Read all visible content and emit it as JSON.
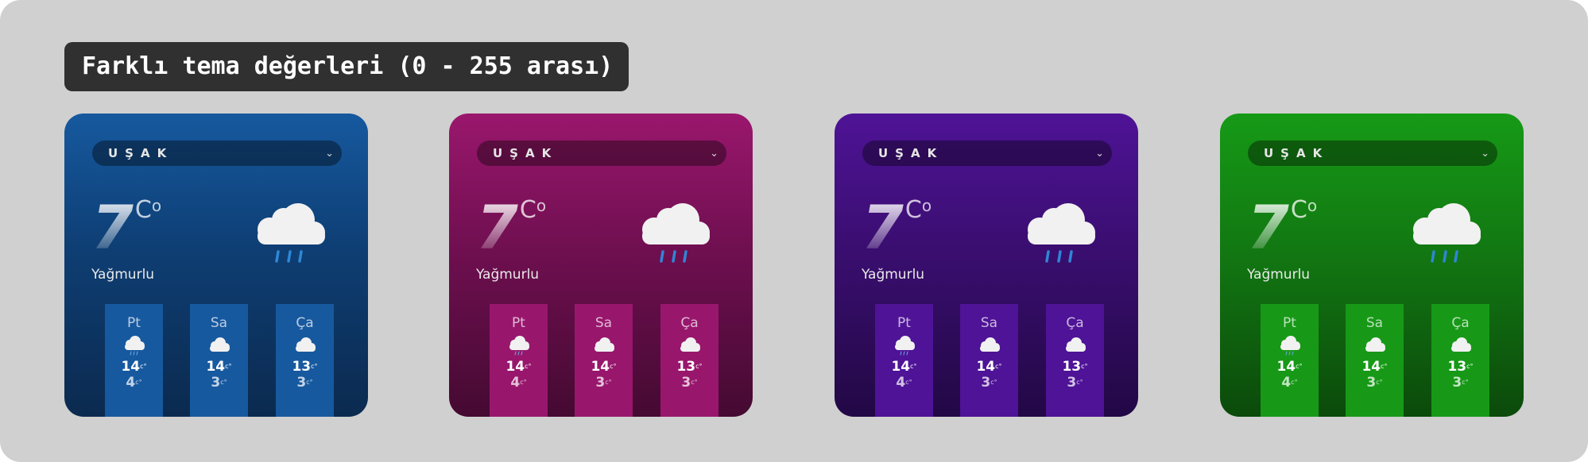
{
  "title": "Farklı tema değerleri (0 - 255 arası)",
  "degree_unit": "C",
  "degree_symbol": "o",
  "small_unit": "c°",
  "cards": [
    {
      "theme": "blue",
      "city": "UŞAK",
      "temperature": "7",
      "condition": "Yağmurlu",
      "weather_icon": "cloud-rain-icon",
      "forecast": [
        {
          "day": "Pt",
          "high": "14",
          "low": "4"
        },
        {
          "day": "Sa",
          "high": "14",
          "low": "3"
        },
        {
          "day": "Ça",
          "high": "13",
          "low": "3"
        }
      ]
    },
    {
      "theme": "pink",
      "city": "UŞAK",
      "temperature": "7",
      "condition": "Yağmurlu",
      "weather_icon": "cloud-rain-icon",
      "forecast": [
        {
          "day": "Pt",
          "high": "14",
          "low": "4"
        },
        {
          "day": "Sa",
          "high": "14",
          "low": "3"
        },
        {
          "day": "Ça",
          "high": "13",
          "low": "3"
        }
      ]
    },
    {
      "theme": "purple",
      "city": "UŞAK",
      "temperature": "7",
      "condition": "Yağmurlu",
      "weather_icon": "cloud-rain-icon",
      "forecast": [
        {
          "day": "Pt",
          "high": "14",
          "low": "4"
        },
        {
          "day": "Sa",
          "high": "14",
          "low": "3"
        },
        {
          "day": "Ça",
          "high": "13",
          "low": "3"
        }
      ]
    },
    {
      "theme": "green",
      "city": "UŞAK",
      "temperature": "7",
      "condition": "Yağmurlu",
      "weather_icon": "cloud-rain-icon",
      "forecast": [
        {
          "day": "Pt",
          "high": "14",
          "low": "4"
        },
        {
          "day": "Sa",
          "high": "14",
          "low": "3"
        },
        {
          "day": "Ça",
          "high": "13",
          "low": "3"
        }
      ]
    }
  ],
  "colors": {
    "blue": "#16599f",
    "pink": "#9a176d",
    "purple": "#4e1396",
    "green": "#169a16",
    "rain": "#2f86d6",
    "cloud": "#f1f1f1"
  }
}
